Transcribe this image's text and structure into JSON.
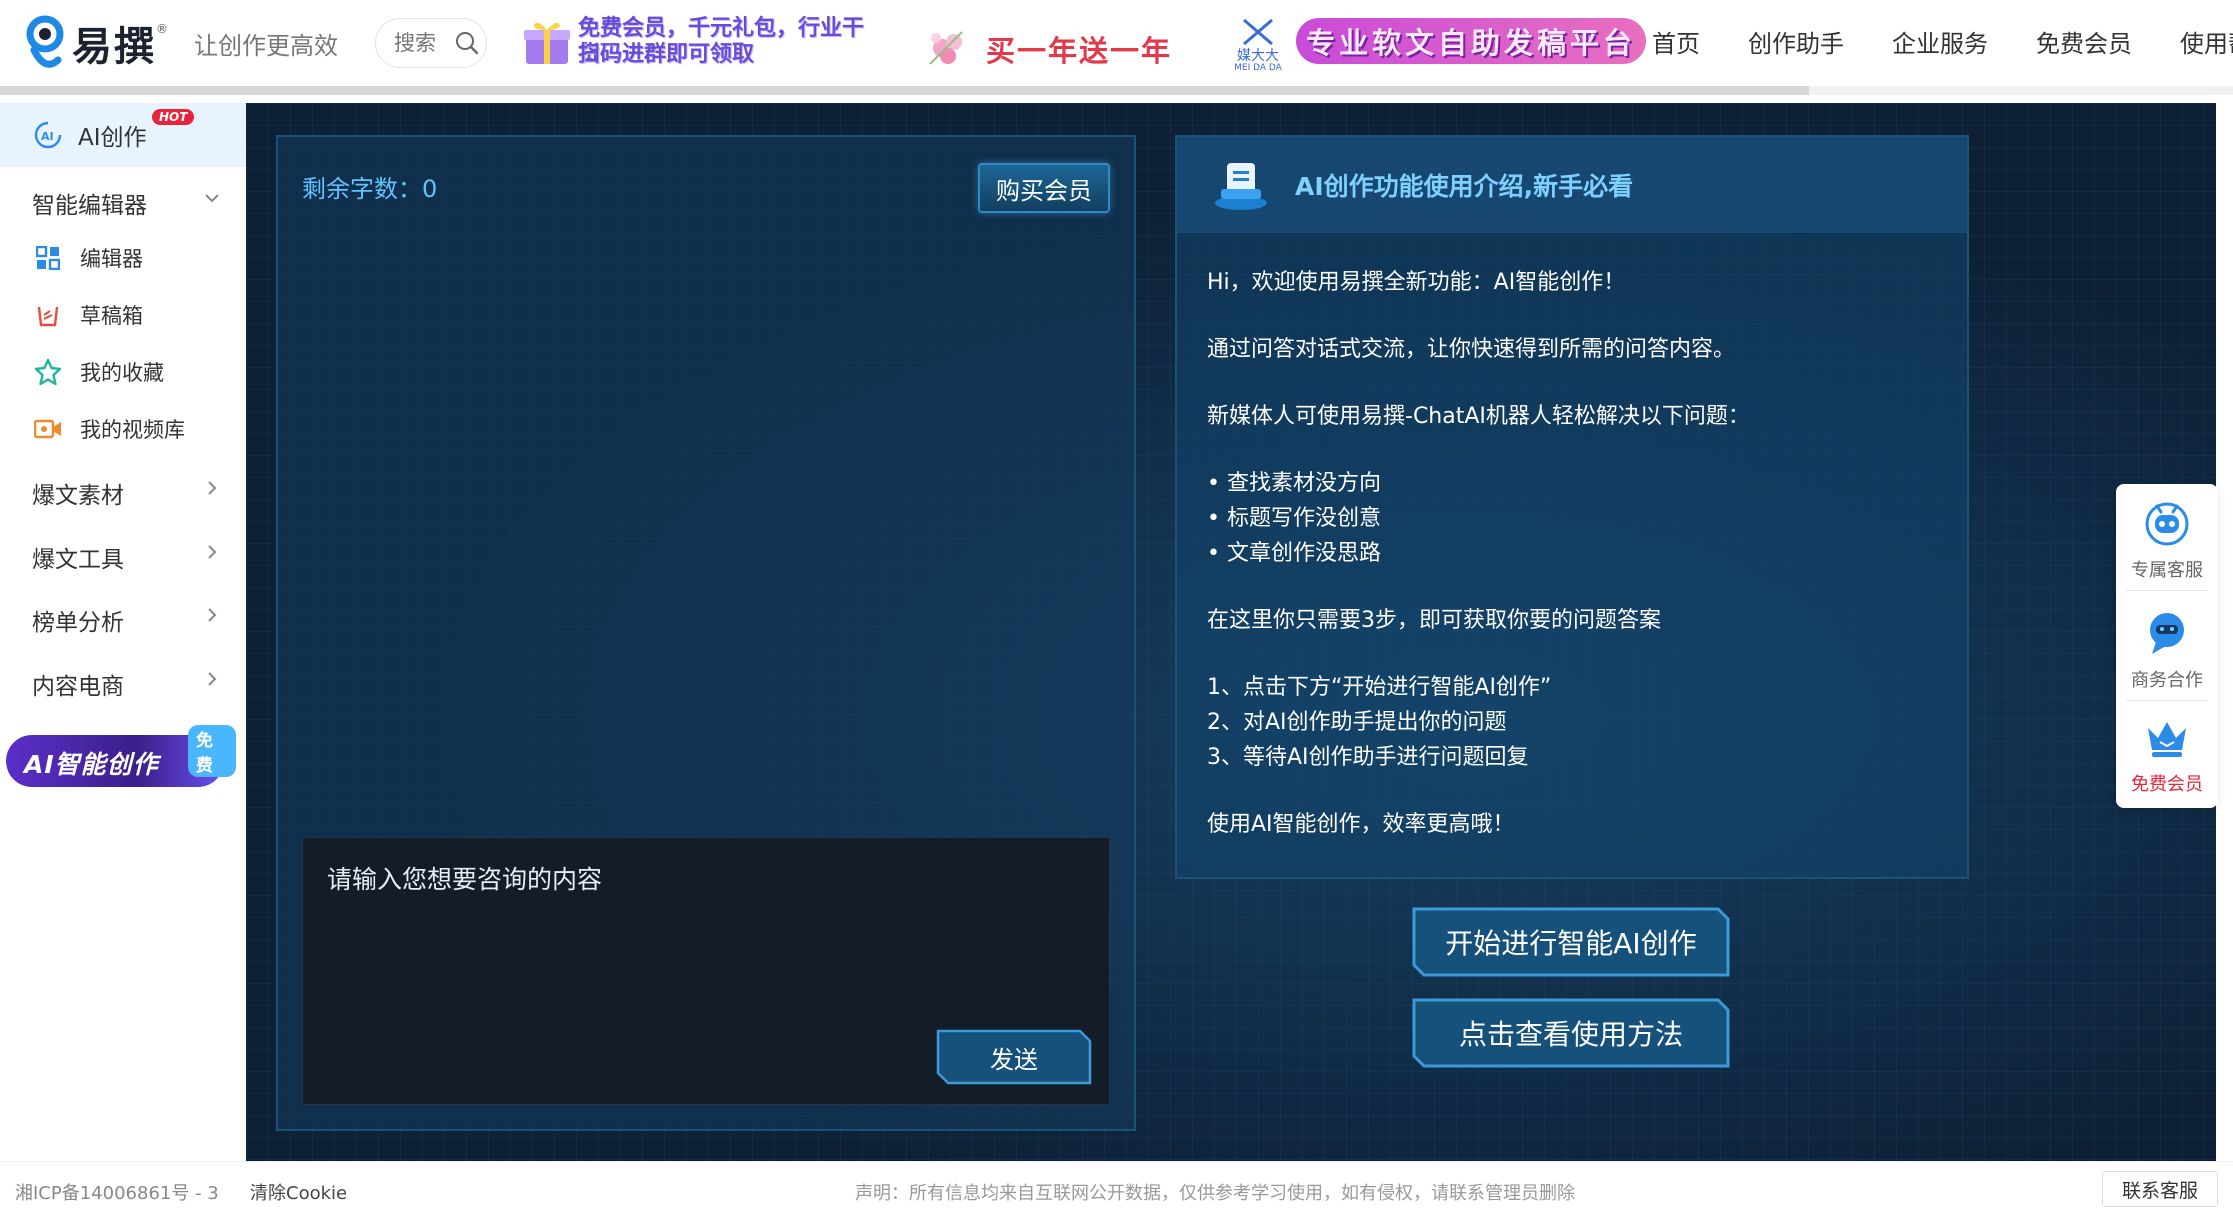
{
  "header": {
    "logo_text": "易撰",
    "slogan": "让创作更高效",
    "search_placeholder": "搜索",
    "banner_vip_line1": "免费会员，千元礼包，行业干货",
    "banner_vip_line2": "扫码进群即可领取",
    "banner_promo": "买一年送一年",
    "banner_brand": "MEI DA DA",
    "banner_brand_cn": "媒大大",
    "banner_softtext": "专业软文自助发稿平台",
    "nav": [
      "首页",
      "创作助手",
      "企业服务",
      "免费会员",
      "使用帮"
    ]
  },
  "sidebar": {
    "ai_label": "AI创作",
    "hot_badge": "HOT",
    "editor_group": "智能编辑器",
    "sub_items": [
      "编辑器",
      "草稿箱",
      "我的收藏",
      "我的视频库"
    ],
    "groups": [
      "爆文素材",
      "爆文工具",
      "榜单分析",
      "内容电商"
    ],
    "promo_text": "AI智能创作",
    "promo_badge": "免费"
  },
  "chat": {
    "words_label": "剩余字数：0",
    "buy_button": "购买会员",
    "input_placeholder": "请输入您想要咨询的内容",
    "send_button": "发送"
  },
  "intro": {
    "title": "AI创作功能使用介绍,新手必看",
    "welcome": "Hi，欢迎使用易撰全新功能：AI智能创作！",
    "desc": "通过问答对话式交流，让你快速得到所需的问答内容。",
    "lead": "新媒体人可使用易撰-ChatAI机器人轻松解决以下问题：",
    "problems": [
      "• 查找素材没方向",
      "• 标题写作没创意",
      "• 文章创作没思路"
    ],
    "steps_intro": "在这里你只需要3步，即可获取你要的问题答案",
    "steps": [
      "1、点击下方“开始进行智能AI创作”",
      "2、对AI创作助手提出你的问题",
      "3、等待AI创作助手进行问题回复"
    ],
    "closing": "使用AI智能创作，效率更高哦！"
  },
  "actions": {
    "start_button": "开始进行智能AI创作",
    "howto_button": "点击查看使用方法"
  },
  "float_bar": {
    "items": [
      "专属客服",
      "商务合作",
      "免费会员"
    ]
  },
  "footer": {
    "icp": "湘ICP备14006861号 - 3",
    "clear_cookie": "清除Cookie",
    "notice": "声明：所有信息均来自互联网公开数据，仅供参考学习使用，如有侵权，请联系管理员删除",
    "contact": "联系客服"
  },
  "colors": {
    "accent_blue": "#5ec3ff",
    "hot_red": "#e8243a",
    "free_vip_red": "#e8243a",
    "panel_bg": "#0d2035"
  },
  "page_progress": 0.81
}
